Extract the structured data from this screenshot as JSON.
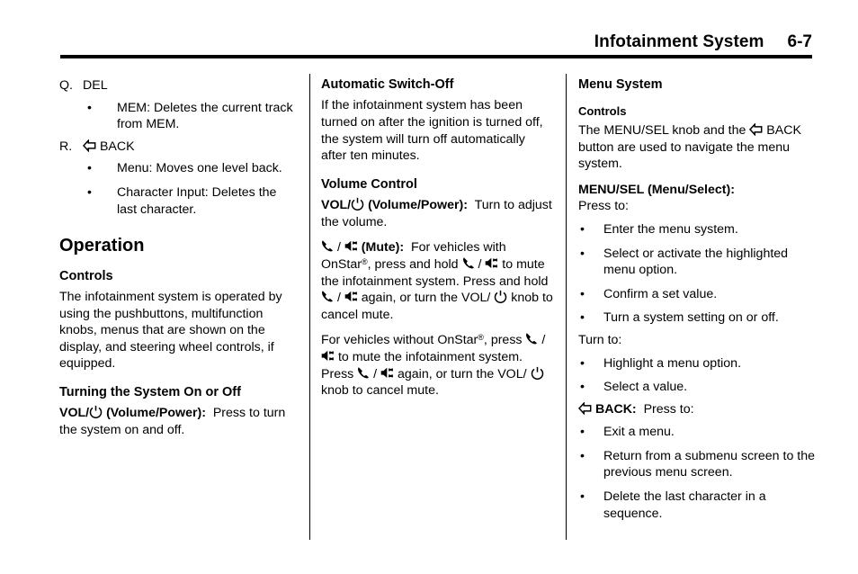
{
  "header": {
    "title": "Infotainment System",
    "page_number": "6-7"
  },
  "icons": {
    "power": "power-icon",
    "back_arrow": "back-arrow-icon",
    "phone": "phone-handset-icon",
    "mute": "mute-speaker-icon"
  },
  "column1": {
    "item_q_marker": "Q.",
    "item_q_label": "DEL",
    "item_q_bullets": [
      "MEM: Deletes the current track from MEM."
    ],
    "item_r_marker": "R.",
    "item_r_label": "BACK",
    "item_r_bullets": [
      "Menu: Moves one level back.",
      "Character Input: Deletes the last character."
    ],
    "operation_heading": "Operation",
    "controls_heading": "Controls",
    "controls_body": "The infotainment system is operated by using the pushbuttons, multifunction knobs, menus that are shown on the display, and steering wheel controls, if equipped.",
    "turning_heading": "Turning the System On or Off",
    "vol_label_prefix": "VOL/",
    "vol_label_suffix": "(Volume/Power):",
    "vol_body": "Press to turn the system on and off."
  },
  "column2": {
    "auto_switch_heading": "Automatic Switch-Off",
    "auto_switch_body": "If the infotainment system has been turned on after the ignition is turned off, the system will turn off automatically after ten minutes.",
    "volume_control_heading": "Volume Control",
    "vol_label_prefix": "VOL/",
    "vol_label_suffix": "(Volume/Power):",
    "vol_body": "Turn to adjust the volume.",
    "mute_label": "(Mute):",
    "mute_text_1": "For vehicles with",
    "mute_text_2": "OnStar",
    "mute_text_2b": ", press and hold",
    "mute_text_3": "to mute the infotainment system.",
    "mute_text_4": "Press and hold",
    "mute_text_5": "again, or turn the VOL/",
    "mute_text_6": "knob to cancel mute.",
    "nostar_text_1": "For vehicles without OnStar",
    "nostar_text_1b": ",",
    "nostar_text_2": "press",
    "nostar_text_3": "to mute the infotainment system. Press",
    "nostar_text_4": "again, or turn the VOL/",
    "nostar_text_5": "knob to cancel mute."
  },
  "column3": {
    "menu_system_heading": "Menu System",
    "controls_heading": "Controls",
    "controls_body_1": "The MENU/SEL knob and the",
    "controls_body_2": "BACK button are used to navigate the menu system.",
    "menusel_heading": "MENU/SEL (Menu/Select):",
    "press_to_label": "Press to:",
    "press_to_bullets": [
      "Enter the menu system.",
      "Select or activate the highlighted menu option.",
      "Confirm a set value.",
      "Turn a system setting on or off."
    ],
    "turn_to_label": "Turn to:",
    "turn_to_bullets": [
      "Highlight a menu option.",
      "Select a value."
    ],
    "back_label": "BACK:",
    "back_press_to": "Press to:",
    "back_bullets": [
      "Exit a menu.",
      "Return from a submenu screen to the previous menu screen.",
      "Delete the last character in a sequence."
    ]
  }
}
